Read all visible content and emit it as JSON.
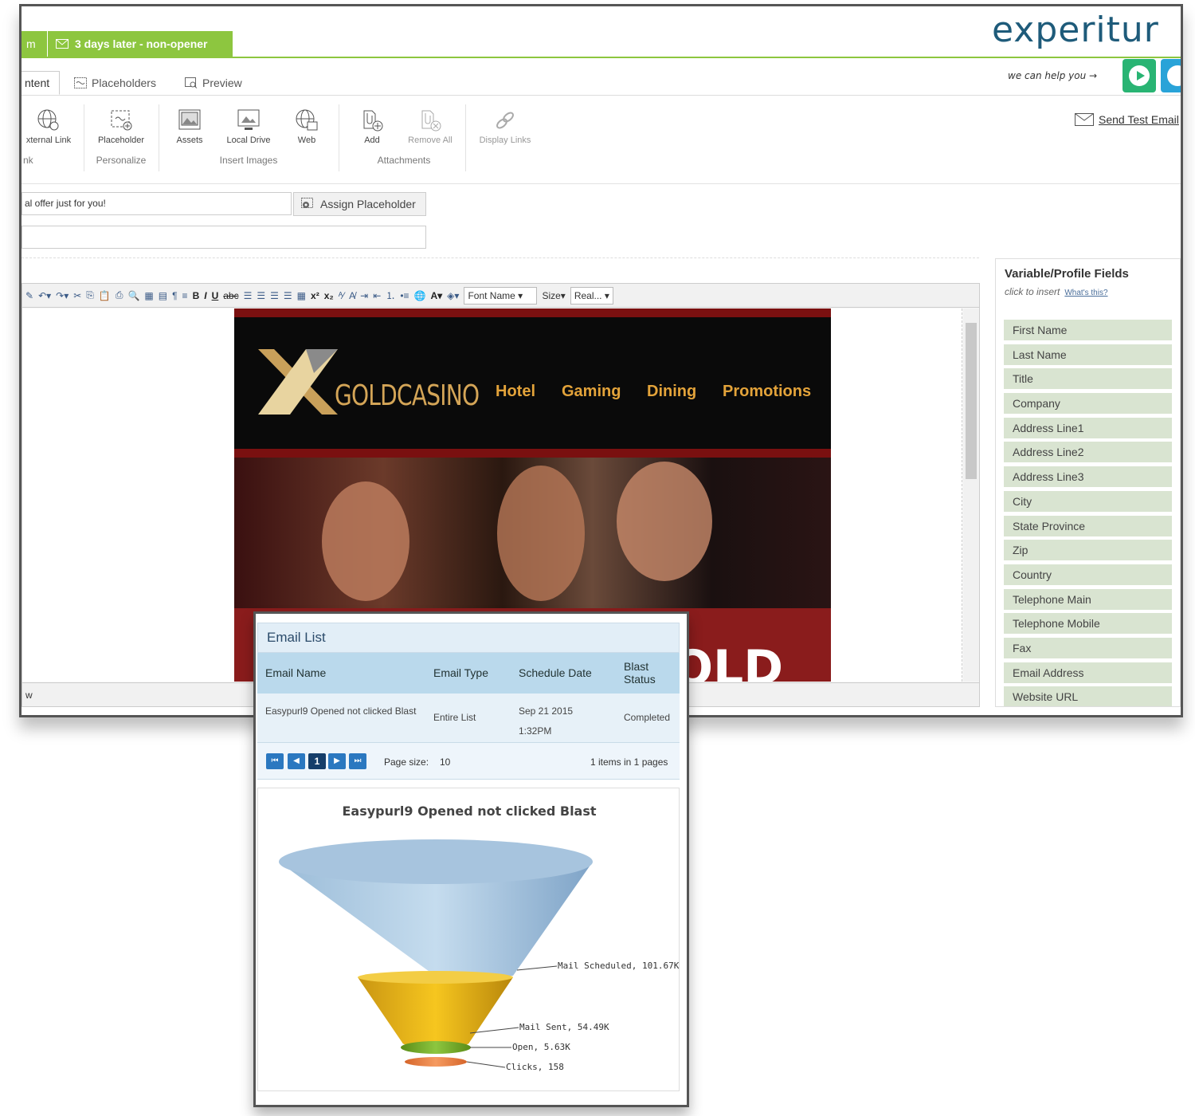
{
  "tabs": {
    "previous_fragment": "m",
    "active": "3 days later - non-opener"
  },
  "logo": {
    "text": "experitur"
  },
  "subtabs": {
    "content_fragment": "ntent",
    "placeholders": "Placeholders",
    "preview": "Preview"
  },
  "help": {
    "text": "we can help you"
  },
  "toolbar": {
    "items": {
      "external_link": "xternal Link",
      "placeholder": "Placeholder",
      "assets": "Assets",
      "local_drive": "Local Drive",
      "web": "Web",
      "add": "Add",
      "remove_all": "Remove All",
      "display_links": "Display Links"
    },
    "groups": {
      "link_fragment": "nk",
      "personalize": "Personalize",
      "insert_images": "Insert Images",
      "attachments": "Attachments"
    },
    "send_test_email": "Send Test Email"
  },
  "subject": {
    "value": "al offer just for you!",
    "assign_button": "Assign Placeholder"
  },
  "editor": {
    "font_name": "Font Name",
    "size": "Size",
    "real": "Real...",
    "status_fragment": "w"
  },
  "email_preview": {
    "brand": "GOLDCASINO",
    "nav": [
      "Hotel",
      "Gaming",
      "Dining",
      "Promotions"
    ],
    "banner_fragment": "OLD"
  },
  "right_panel": {
    "title": "Variable/Profile Fields",
    "subtitle": "click to insert",
    "whats_this": "What's this?",
    "fields": [
      "First Name",
      "Last Name",
      "Title",
      "Company",
      "Address Line1",
      "Address Line2",
      "Address Line3",
      "City",
      "State Province",
      "Zip",
      "Country",
      "Telephone Main",
      "Telephone Mobile",
      "Fax",
      "Email Address",
      "Website URL"
    ]
  },
  "email_list": {
    "title": "Email List",
    "columns": [
      "Email Name",
      "Email Type",
      "Schedule Date",
      "Blast Status"
    ],
    "rows": [
      {
        "name": "Easypurl9 Opened not clicked Blast",
        "type": "Entire List",
        "date": "Sep 21 2015 1:32PM",
        "status": "Completed"
      }
    ],
    "pager": {
      "current_page": "1",
      "page_size_label": "Page size:",
      "page_size": "10",
      "summary": "1 items in 1 pages"
    }
  },
  "chart_data": {
    "type": "funnel",
    "title": "Easypurl9 Opened not clicked Blast",
    "series": [
      {
        "name": "Mail Scheduled",
        "value": 101670,
        "label": "Mail Scheduled, 101.67K",
        "color": "#8fb3d4"
      },
      {
        "name": "Mail Sent",
        "value": 54490,
        "label": "Mail Sent, 54.49K",
        "color": "#e2b21f"
      },
      {
        "name": "Open",
        "value": 5630,
        "label": "Open, 5.63K",
        "color": "#6fa823"
      },
      {
        "name": "Clicks",
        "value": 158,
        "label": "Clicks, 158",
        "color": "#e8773a"
      }
    ]
  },
  "colors": {
    "accent_green": "#8dc63f",
    "brand_blue": "#1e5b7a",
    "field_bg": "#d9e4d1",
    "grid_header": "#bad9ec"
  }
}
